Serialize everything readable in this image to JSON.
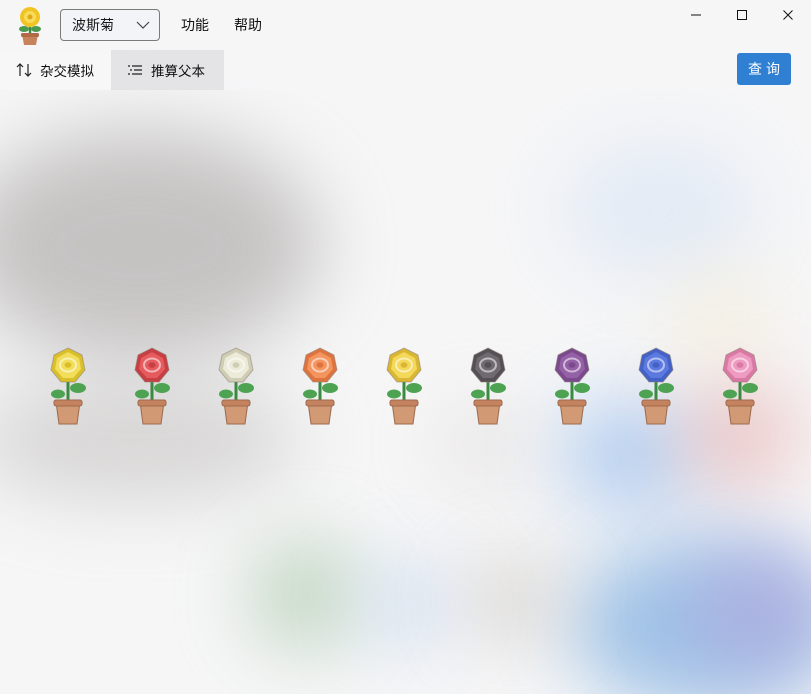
{
  "app": {
    "logo_icon": "flower-pot-logo-icon",
    "selected_plant": "波斯菊"
  },
  "menu": {
    "func_label": "功能",
    "help_label": "帮助"
  },
  "window_controls": [
    "minimize-icon",
    "maximize-icon",
    "close-icon"
  ],
  "toolbar": {
    "cross_label": "杂交模拟",
    "infer_label": "推算父本",
    "query_label": "查询"
  },
  "flowers": [
    {
      "name": "yellow",
      "color": "#f2de5a",
      "shade": "#d9bf2b"
    },
    {
      "name": "red",
      "color": "#e55b5e",
      "shade": "#c63f44"
    },
    {
      "name": "white",
      "color": "#ecebd9",
      "shade": "#cfcdb4"
    },
    {
      "name": "orange",
      "color": "#f49560",
      "shade": "#dd7440"
    },
    {
      "name": "gold",
      "color": "#f4d85a",
      "shade": "#d9b633"
    },
    {
      "name": "black",
      "color": "#6f6a70",
      "shade": "#545056"
    },
    {
      "name": "purple",
      "color": "#9561a6",
      "shade": "#7a4a8d"
    },
    {
      "name": "blue",
      "color": "#5c79e0",
      "shade": "#4462c6"
    },
    {
      "name": "pink",
      "color": "#ef9ac0",
      "shade": "#d97aa5"
    }
  ]
}
